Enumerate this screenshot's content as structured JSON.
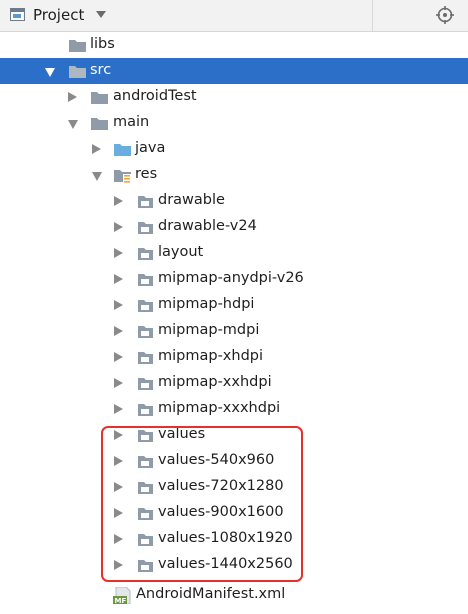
{
  "header": {
    "title": "Project",
    "icons": [
      "project-window-icon",
      "dropdown-chevron-icon",
      "locate-target-icon"
    ]
  },
  "tree": {
    "rows": [
      {
        "label": "libs",
        "icon": "folder-icon",
        "arrow": "none",
        "selected": false
      },
      {
        "label": "src",
        "icon": "folder-icon",
        "arrow": "expanded",
        "selected": true
      },
      {
        "label": "androidTest",
        "icon": "folder-icon",
        "arrow": "collapsed",
        "selected": false
      },
      {
        "label": "main",
        "icon": "folder-icon",
        "arrow": "expanded",
        "selected": false
      },
      {
        "label": "java",
        "icon": "source-folder-icon",
        "arrow": "collapsed",
        "selected": false
      },
      {
        "label": "res",
        "icon": "resource-folder-icon",
        "arrow": "expanded",
        "selected": false
      },
      {
        "label": "drawable",
        "icon": "folder-icon",
        "arrow": "collapsed",
        "selected": false
      },
      {
        "label": "drawable-v24",
        "icon": "folder-icon",
        "arrow": "collapsed",
        "selected": false
      },
      {
        "label": "layout",
        "icon": "folder-icon",
        "arrow": "collapsed",
        "selected": false
      },
      {
        "label": "mipmap-anydpi-v26",
        "icon": "folder-icon",
        "arrow": "collapsed",
        "selected": false
      },
      {
        "label": "mipmap-hdpi",
        "icon": "folder-icon",
        "arrow": "collapsed",
        "selected": false
      },
      {
        "label": "mipmap-mdpi",
        "icon": "folder-icon",
        "arrow": "collapsed",
        "selected": false
      },
      {
        "label": "mipmap-xhdpi",
        "icon": "folder-icon",
        "arrow": "collapsed",
        "selected": false
      },
      {
        "label": "mipmap-xxhdpi",
        "icon": "folder-icon",
        "arrow": "collapsed",
        "selected": false
      },
      {
        "label": "mipmap-xxxhdpi",
        "icon": "folder-icon",
        "arrow": "collapsed",
        "selected": false
      },
      {
        "label": "values",
        "icon": "folder-icon",
        "arrow": "collapsed",
        "selected": false
      },
      {
        "label": "values-540x960",
        "icon": "folder-icon",
        "arrow": "collapsed",
        "selected": false
      },
      {
        "label": "values-720x1280",
        "icon": "folder-icon",
        "arrow": "collapsed",
        "selected": false
      },
      {
        "label": "values-900x1600",
        "icon": "folder-icon",
        "arrow": "collapsed",
        "selected": false
      },
      {
        "label": "values-1080x1920",
        "icon": "folder-icon",
        "arrow": "collapsed",
        "selected": false
      },
      {
        "label": "values-1440x2560",
        "icon": "folder-icon",
        "arrow": "collapsed",
        "selected": false
      },
      {
        "label": "AndroidManifest.xml",
        "icon": "manifest-file-icon",
        "arrow": "none",
        "selected": false
      }
    ]
  },
  "colors": {
    "selection": "#2c6fc9",
    "highlight_box": "#e8302a",
    "folder": "#8f9ba8",
    "source_folder": "#6aaee0"
  }
}
